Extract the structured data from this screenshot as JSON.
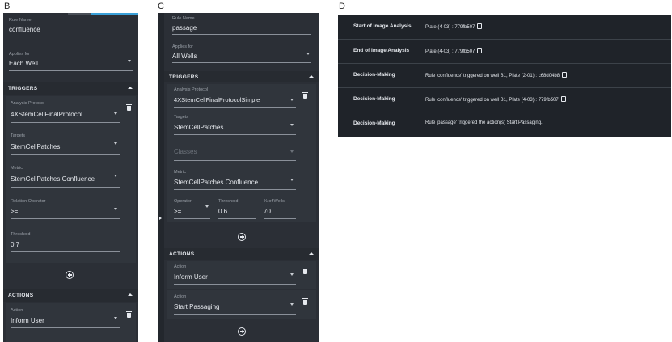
{
  "panels": {
    "b": {
      "letter": "B",
      "rule_name": {
        "label": "Rule Name",
        "value": "confluence"
      },
      "applies_for": {
        "label": "Applies for",
        "value": "Each Well"
      },
      "triggers_title": "TRIGGERS",
      "analysis_protocol": {
        "label": "Analysis Protocol",
        "value": "4XStemCellFinalProtocol"
      },
      "targets": {
        "label": "Targets",
        "value": "StemCellPatches"
      },
      "metric": {
        "label": "Metric",
        "value": "StemCellPatches Confluence"
      },
      "relation_operator": {
        "label": "Relation Operator",
        "value": ">="
      },
      "threshold": {
        "label": "Threshold",
        "value": "0.7"
      },
      "actions_title": "ACTIONS",
      "action": {
        "label": "Action",
        "value": "Inform User"
      }
    },
    "c": {
      "letter": "C",
      "rule_name": {
        "label": "Rule Name",
        "value": "passage"
      },
      "applies_for": {
        "label": "Applies for",
        "value": "All Wells"
      },
      "triggers_title": "TRIGGERS",
      "analysis_protocol": {
        "label": "Analysis Protocol",
        "value": "4XStemCellFinalProtocolSimple"
      },
      "targets": {
        "label": "Targets",
        "value": "StemCellPatches"
      },
      "classes": {
        "placeholder": "Classes"
      },
      "metric": {
        "label": "Metric",
        "value": "StemCellPatches Confluence"
      },
      "operator": {
        "label": "Operator",
        "value": ">="
      },
      "threshold": {
        "label": "Threshold",
        "value": "0.6"
      },
      "pct_wells": {
        "label": "% of Wells",
        "value": "70"
      },
      "actions_title": "ACTIONS",
      "action1": {
        "label": "Action",
        "value": "Inform User"
      },
      "action2": {
        "label": "Action",
        "value": "Start Passaging"
      }
    },
    "d": {
      "letter": "D",
      "log": [
        {
          "event": "Start of Image Analysis",
          "message": "Plate (4-03) : 779fb507",
          "icon": "plate-icon"
        },
        {
          "event": "End of Image Analysis",
          "message": "Plate (4-03) : 779fb507",
          "icon": "plate-icon"
        },
        {
          "event": "Decision-Making",
          "message": "Rule 'confluence' triggered on well B1, Plate (2-01) : c68d04b8",
          "icon": "plate-icon"
        },
        {
          "event": "Decision-Making",
          "message": "Rule 'confluence' triggered on well B1, Plate (4-03) : 779fb507",
          "icon": "plate-icon"
        },
        {
          "event": "Decision-Making",
          "message": "Rule 'passage' triggered the action(s) Start Passaging.",
          "icon": ""
        }
      ]
    }
  },
  "colors": {
    "panel_bg": "#2b2f36",
    "log_bg": "#1f2329",
    "text": "#e6e9ee",
    "accent": "#3aa0d8"
  }
}
